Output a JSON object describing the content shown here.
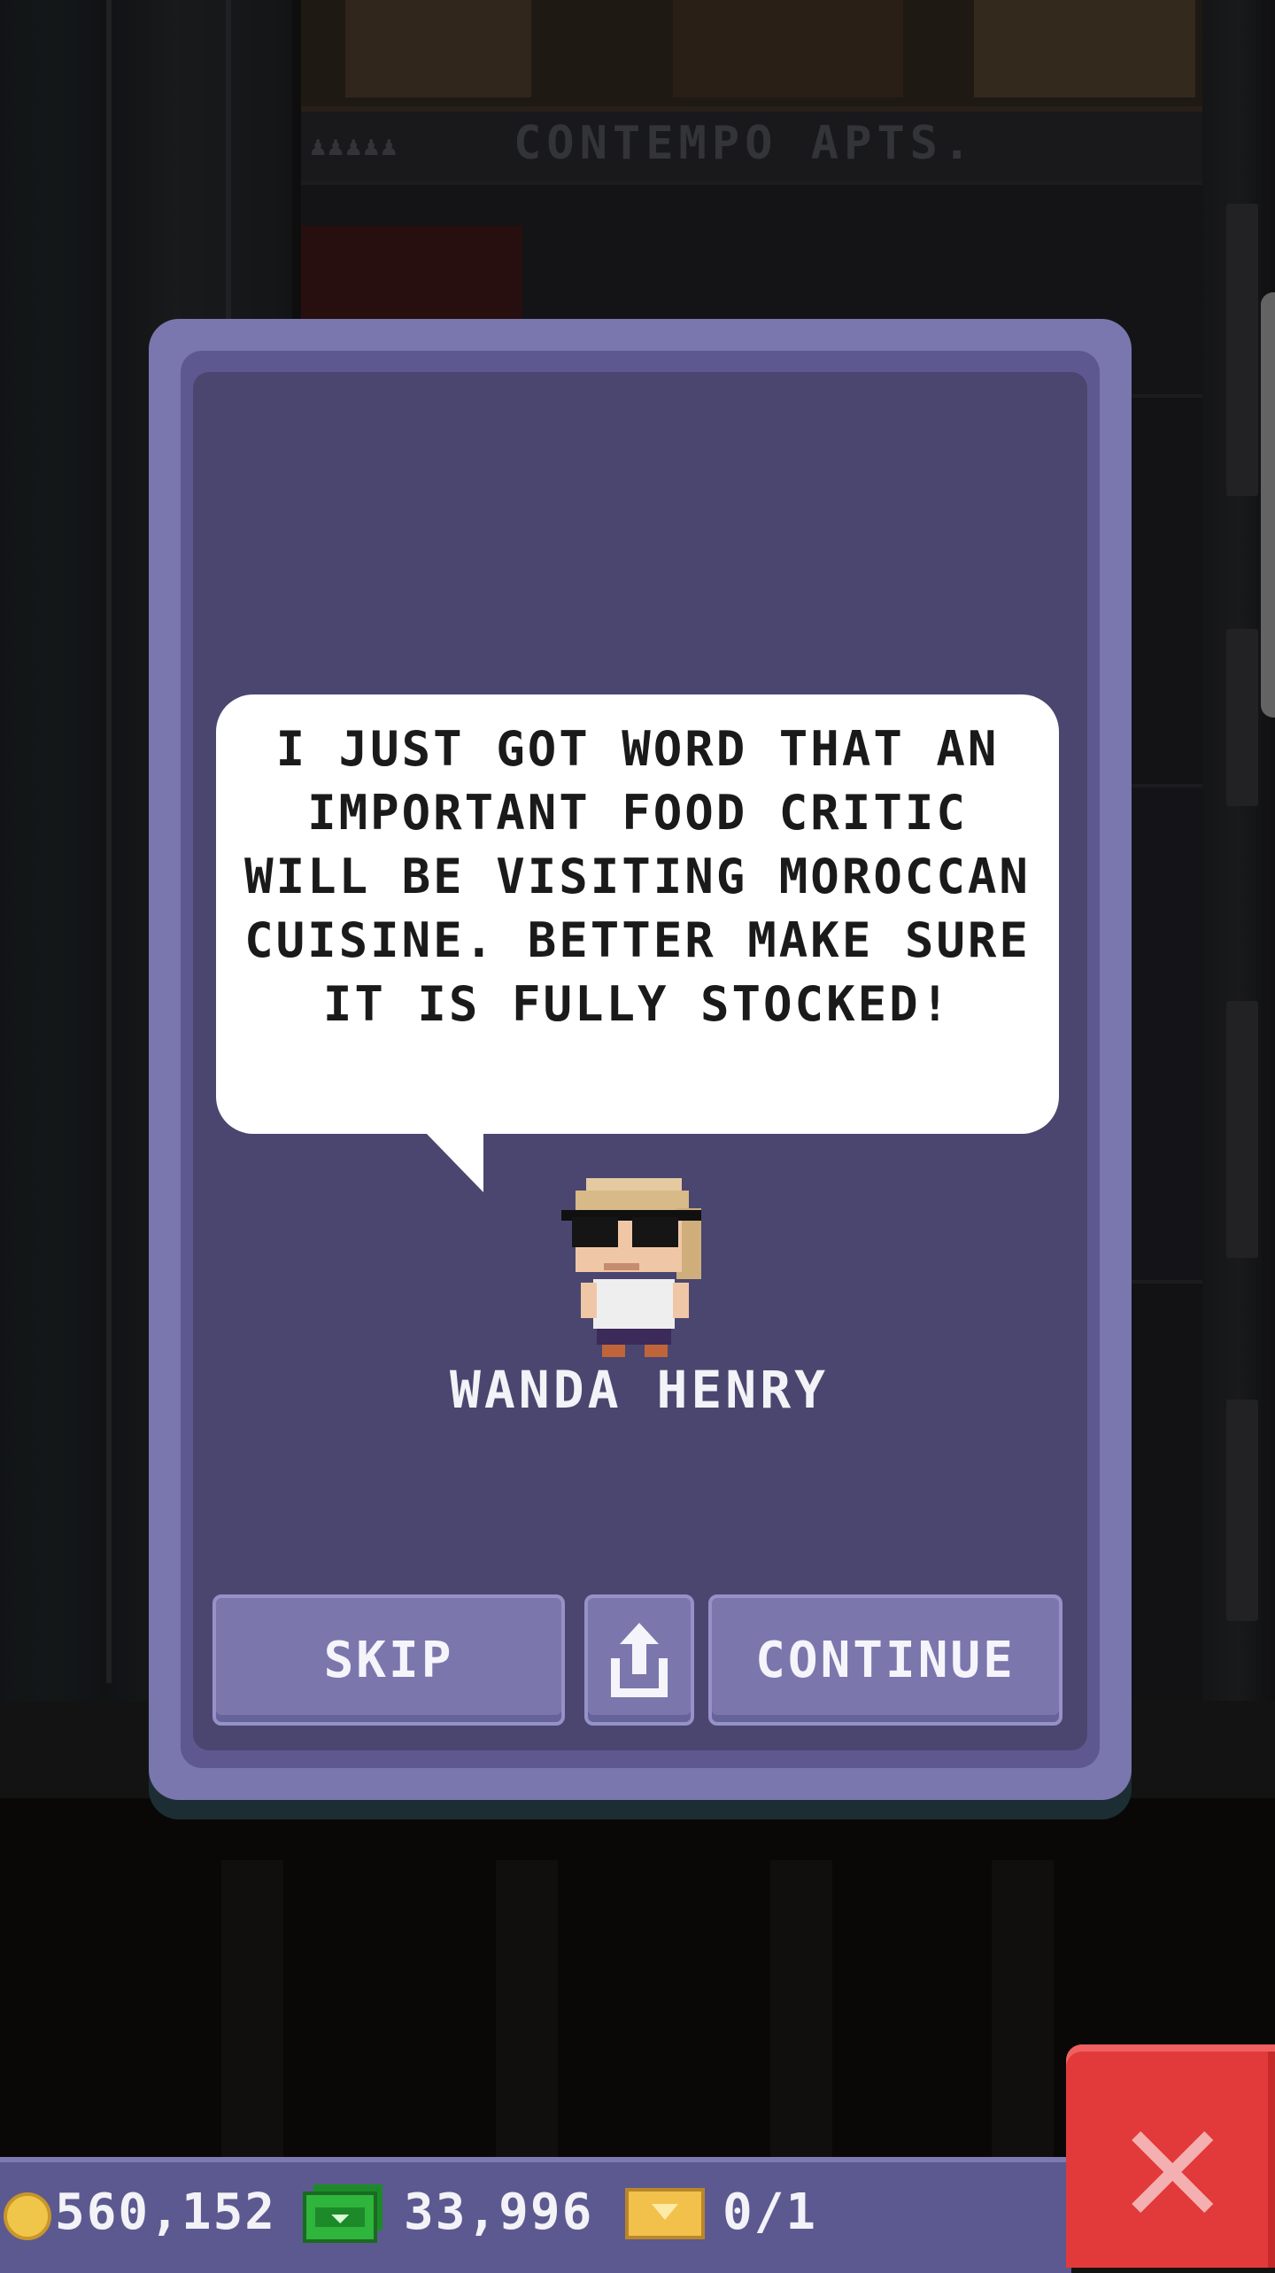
{
  "background": {
    "floor_label": "CONTEMPO APTS."
  },
  "dialog": {
    "message": "I JUST GOT WORD THAT AN IMPORTANT FOOD CRITIC WILL BE VISITING MOROCCAN CUISINE. BETTER MAKE SURE IT IS FULLY STOCKED!",
    "character_name": "WANDA HENRY",
    "buttons": {
      "skip": "SKIP",
      "share_icon": "share-icon",
      "continue": "CONTINUE"
    }
  },
  "status_bar": {
    "coins": "560,152",
    "bux": "33,996",
    "tickets": "0/1"
  },
  "colors": {
    "card": "#7a76ae",
    "card_inner": "#4a466f",
    "button": "#7b77ad",
    "close_button": "#e23a3a"
  }
}
